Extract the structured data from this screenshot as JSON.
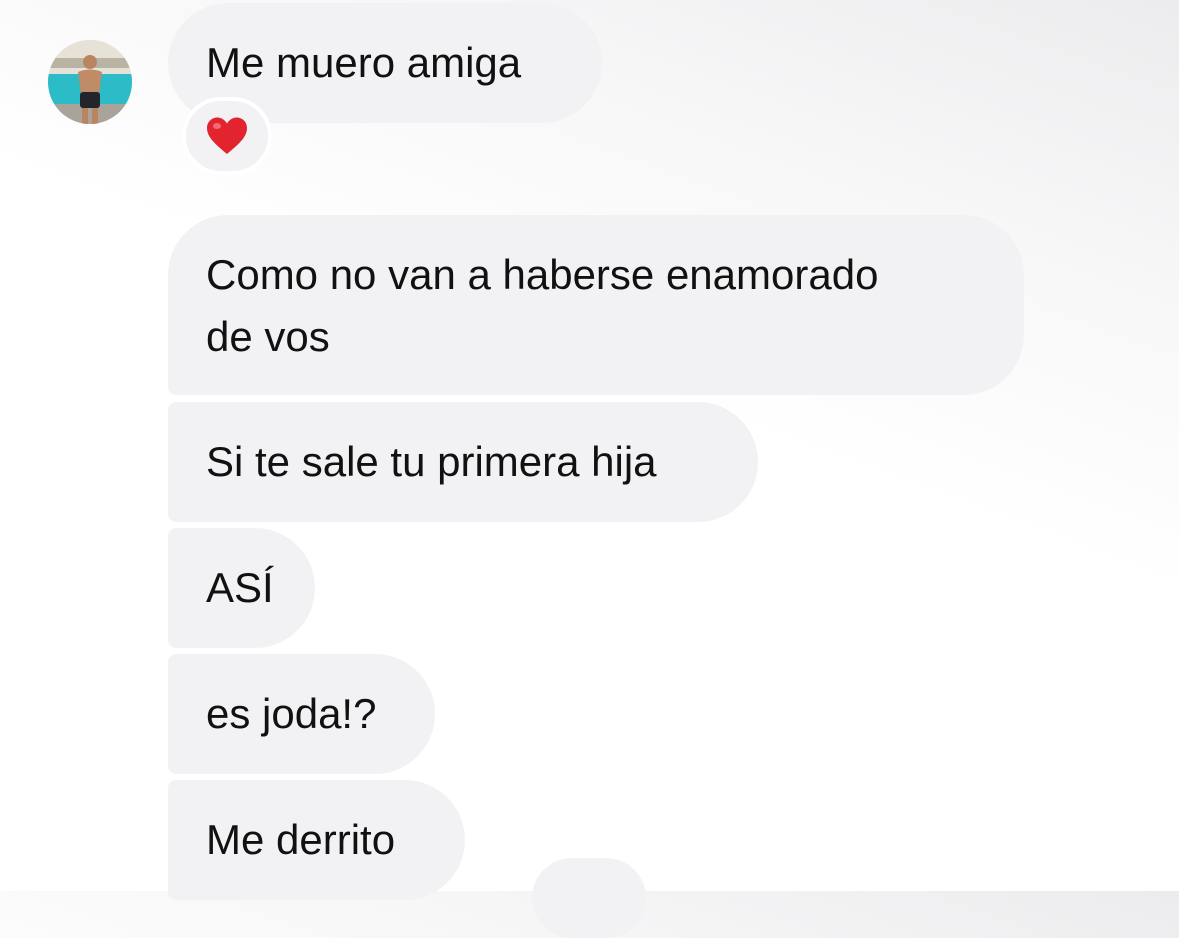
{
  "conversation": {
    "contact": {
      "avatar_icon": "profile-photo-avatar"
    },
    "messages": [
      {
        "lines": [
          "Me muero amiga"
        ],
        "reaction": "heart-emoji"
      },
      {
        "lines": [
          "Como no van a haberse enamorado",
          "de vos"
        ]
      },
      {
        "lines": [
          "Si te sale tu primera hija"
        ]
      },
      {
        "lines": [
          "ASÍ"
        ]
      },
      {
        "lines": [
          "es joda!?"
        ]
      },
      {
        "lines": [
          "Me derrito"
        ]
      }
    ]
  },
  "colors": {
    "incoming_bubble": "#f2f2f4",
    "text": "#111111",
    "reaction_heart": "#e2242f"
  }
}
